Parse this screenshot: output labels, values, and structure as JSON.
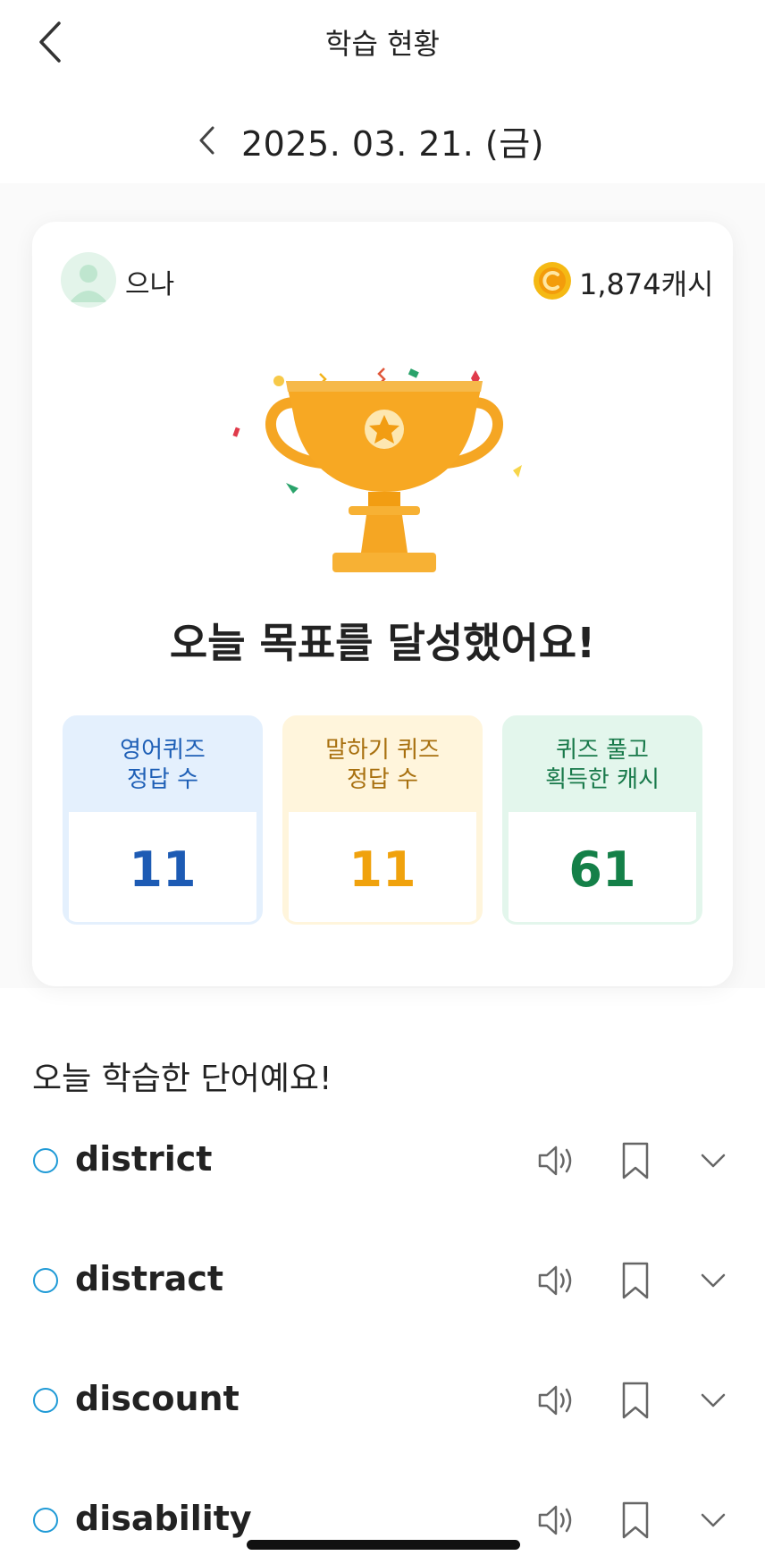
{
  "header": {
    "title": "학습 현황",
    "date": "2025. 03. 21. (금)"
  },
  "user": {
    "name": "으나",
    "cash": "1,874캐시"
  },
  "card": {
    "goal_message": "오늘 목표를 달성했어요!",
    "stats": [
      {
        "label_line1": "영어퀴즈",
        "label_line2": "정답 수",
        "value": "11",
        "color": "#1d5bb4"
      },
      {
        "label_line1": "말하기 퀴즈",
        "label_line2": "정답 수",
        "value": "11",
        "color": "#f0a20d"
      },
      {
        "label_line1": "퀴즈 풀고",
        "label_line2": "획득한 캐시",
        "value": "61",
        "color": "#148048"
      }
    ]
  },
  "words_section": {
    "title": "오늘 학습한 단어예요!",
    "words": [
      "district",
      "distract",
      "discount",
      "disability"
    ]
  },
  "icons": [
    "back-arrow-icon",
    "chevron-left-icon",
    "avatar-icon",
    "coin-icon",
    "trophy-icon",
    "speaker-icon",
    "bookmark-icon",
    "chevron-down-icon"
  ],
  "colors": {
    "accent_blue": "#1f9ad6",
    "trophy": "#f7a823",
    "coin": "#f5b914"
  }
}
